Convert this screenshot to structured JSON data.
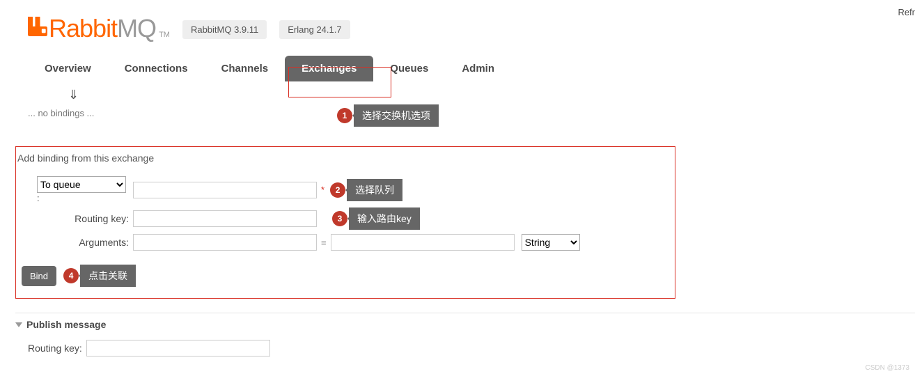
{
  "top_right": "Refr",
  "logo": {
    "rabbit": "Rabbit",
    "mq": "MQ",
    "tm": "TM"
  },
  "badges": {
    "version": "RabbitMQ 3.9.11",
    "erlang": "Erlang 24.1.7"
  },
  "tabs": {
    "overview": "Overview",
    "connections": "Connections",
    "channels": "Channels",
    "exchanges": "Exchanges",
    "queues": "Queues",
    "admin": "Admin"
  },
  "no_bindings": "... no bindings ...",
  "binding_section": {
    "title": "Add binding from this exchange",
    "to_label": "To queue",
    "routing_key_label": "Routing key:",
    "arguments_label": "Arguments:",
    "type_option": "String",
    "bind_button": "Bind",
    "star": "*",
    "eq": "="
  },
  "callouts": {
    "c1": {
      "num": "1",
      "text": "选择交换机选项"
    },
    "c2": {
      "num": "2",
      "text": "选择队列"
    },
    "c3": {
      "num": "3",
      "text": "输入路由key"
    },
    "c4": {
      "num": "4",
      "text": "点击关联"
    }
  },
  "publish": {
    "title": "Publish message",
    "routing_key_label": "Routing key:"
  },
  "watermark": "CSDN @1373"
}
